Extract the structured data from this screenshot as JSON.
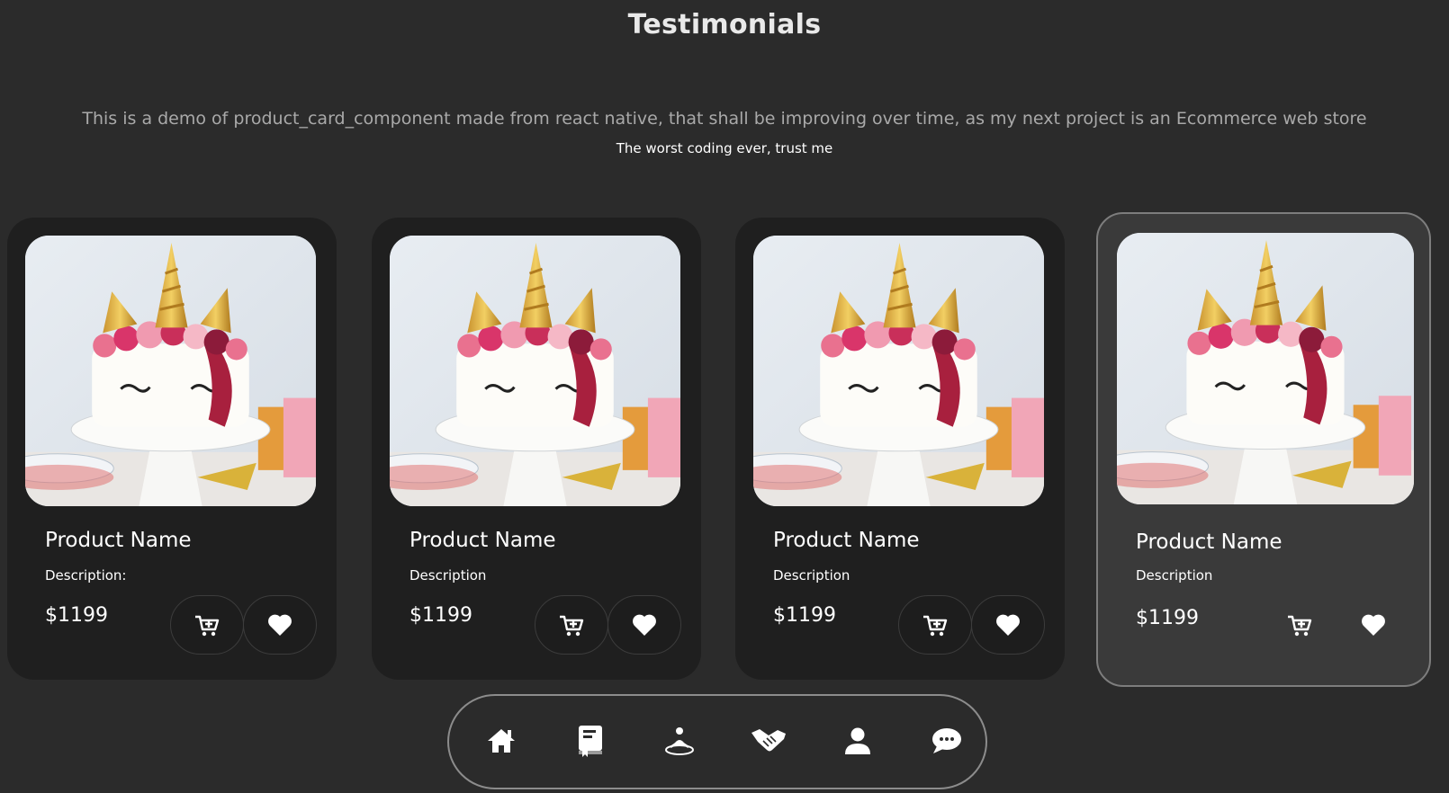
{
  "page": {
    "title": "Testimonials",
    "subtitle": "This is a demo of product_card_component made from react native, that shall be improving over time, as my next project is an Ecommerce web store",
    "tagline": "The worst coding ever, trust me"
  },
  "cards": [
    {
      "name": "Product Name",
      "description": "Description:",
      "price": "$1199",
      "image": "unicorn-cake-photo",
      "highlighted": false
    },
    {
      "name": "Product Name",
      "description": "Description",
      "price": "$1199",
      "image": "unicorn-cake-photo",
      "highlighted": false
    },
    {
      "name": "Product Name",
      "description": "Description",
      "price": "$1199",
      "image": "unicorn-cake-photo",
      "highlighted": false
    },
    {
      "name": "Product Name",
      "description": "Description",
      "price": "$1199",
      "image": "unicorn-cake-photo",
      "highlighted": true
    }
  ],
  "card_icons": {
    "cart": "add-to-cart-icon",
    "favorite": "heart-icon"
  },
  "navbar": {
    "items": [
      {
        "icon": "home-icon"
      },
      {
        "icon": "book-icon"
      },
      {
        "icon": "meditation-icon"
      },
      {
        "icon": "handshake-icon"
      },
      {
        "icon": "user-icon"
      },
      {
        "icon": "chat-icon"
      }
    ]
  },
  "colors": {
    "background": "#2b2b2b",
    "card": "#1f1f1f",
    "card_highlighted": "#3a3a3a",
    "text": "#ffffff",
    "subtitle_text": "#a9a9a9"
  }
}
